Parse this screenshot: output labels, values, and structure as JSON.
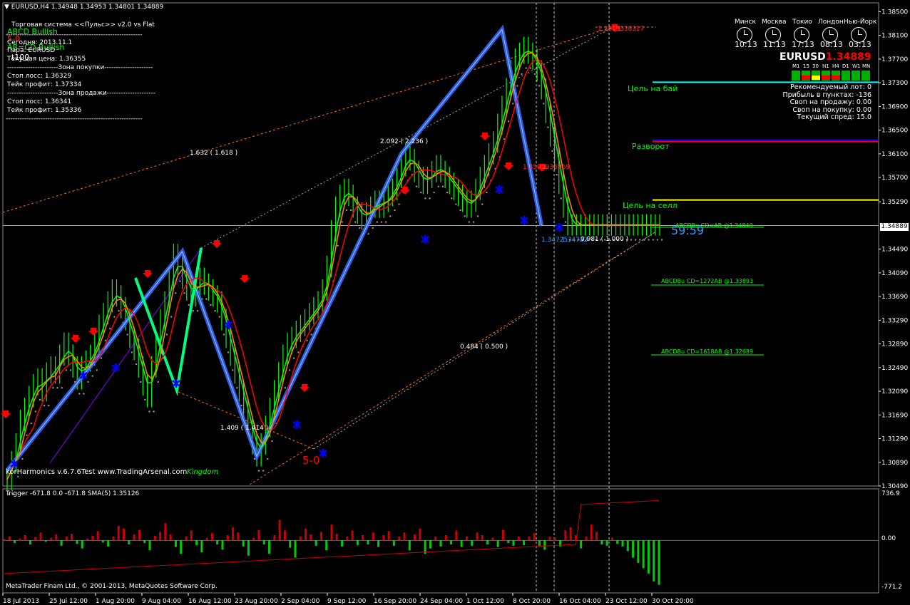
{
  "window": {
    "symbol_header": "EURUSD,H4  1.34948 1.34953 1.34801 1.34889"
  },
  "info_panel": {
    "title": "Торговая система <<Пульс>> v2.0 vs Flat",
    "patterns": [
      "ABCD Bullish",
      "5-0",
      "AB=CD Bullish"
    ],
    "rows": [
      "Сегодня:  2013.11.1",
      "Пара:    EURUSD",
      "Текущая цена: 1.36355",
      "----------------------Зона покупки---------------------",
      "Стоп лосс:       1.36329",
      "Тейк профит:    1.37334",
      "----------------------Зона продажи---------------------",
      "Стоп лосс:       1.36341",
      "Тейк профит:    1.35336"
    ],
    "separator": "-----------------------------------------------------------",
    "mini": "t100"
  },
  "clocks": [
    {
      "city": "Минск",
      "time": "10:13"
    },
    {
      "city": "Москва",
      "time": "11:13"
    },
    {
      "city": "Токио",
      "time": "17:13"
    },
    {
      "city": "Лондон",
      "time": "08:13"
    },
    {
      "city": "Нью-Йорк",
      "time": "03:13"
    }
  ],
  "price_header": {
    "symbol": "EURUSD",
    "price": "1.34889"
  },
  "timeframes": [
    "M1",
    "15",
    "30",
    "H1",
    "H4",
    "D1",
    "W1",
    "MN"
  ],
  "stats": [
    "Рекомендуемый лот: 0",
    "Прибыль в пунктах: -136",
    "Своп на продажу: 0.00",
    "Своп на покупку: 0.00",
    "Текущий спред: 15.0"
  ],
  "annotations": {
    "target_buy": "Цель  на бай",
    "target_sell": "Цель  на селл",
    "reversal": "Разворот",
    "fib_1": "1.632 ( 1.618 )",
    "fib_2": "2.092 ( 2.236 )",
    "fib_3": "1.409 ( 1.414 )",
    "fib_4": "0.484 ( 0.500 )",
    "fib_5": "0.981 ( 1.000 )",
    "point_50": "5-0",
    "countdown": "59:59",
    "top_label": "1.38193",
    "top_label2": "1.38317",
    "mid_label": "1.35999",
    "mid_label2": "1.35969",
    "low_label": "1.34725",
    "low_label2": "1.34722",
    "abcd_1": "ABCDBu CD=AB   @1.34840",
    "abcd_2": "ABCDBu CD=1272AB   @1.33893",
    "abcd_3": "ABCDBu CD=1618AB   @1.32689",
    "harmonics": "korHarmonics v.6.7.6Test  www.TradingArsenal.com",
    "kingdom": "Kingdom"
  },
  "indicator": {
    "label": "Trigger -671.8 0.0 -671.8  SMA(5) 1.35126",
    "y_top": "736.9",
    "y_mid": "0.00",
    "y_bottom": "-771.2"
  },
  "copyright": "MetaTrader Finam Ltd., © 2001-2013, MetaQuotes Software Corp.",
  "colors": {
    "background": "#000000",
    "bull_bars": "#00ff00",
    "bear_arrow": "#ff0000",
    "bull_arrow": "#0000ff",
    "zigzag": "#3366ff",
    "ma_orange": "#ff8c00",
    "ma_green": "#00ff00",
    "target_buy_line": "#00ffff",
    "target_sell_line": "#ffff00",
    "osc_red": "#cc0000",
    "osc_green": "#00cc00"
  },
  "chart_data": {
    "type": "line",
    "title": "",
    "y_ticks": [
      "1.38500",
      "1.38100",
      "1.37700",
      "1.37300",
      "1.36900",
      "1.36500",
      "1.36100",
      "1.35700",
      "1.35290",
      "1.34889",
      "1.34490",
      "1.34090",
      "1.33690",
      "1.33290",
      "1.32890",
      "1.32490",
      "1.32090",
      "1.31690",
      "1.31290",
      "1.30890",
      "1.30490"
    ],
    "ylim": [
      1.3049,
      1.3865
    ],
    "x_ticks": [
      "18 Jul 2013",
      "25 Jul 12:00",
      "1 Aug 20:00",
      "9 Aug 04:00",
      "16 Aug 12:00",
      "23 Aug 20:00",
      "2 Sep 04:00",
      "9 Sep 12:00",
      "16 Sep 20:00",
      "24 Sep 04:00",
      "1 Oct 12:00",
      "8 Oct 20:00",
      "16 Oct 04:00",
      "23 Oct 12:00",
      "30 Oct 20:00"
    ],
    "current_price": 1.34889,
    "target_buy_price": 1.3731,
    "target_sell_price": 1.3532,
    "resistance_price": 1.3632,
    "series": [
      {
        "x": [
          0,
          1,
          2,
          3,
          4,
          5,
          6,
          7,
          8,
          9,
          10,
          11,
          12,
          13,
          14,
          15,
          16,
          17,
          18,
          19,
          20,
          21,
          22,
          23,
          24,
          25,
          26,
          27,
          28,
          29,
          30,
          31,
          32,
          33,
          34,
          35,
          36,
          37,
          38,
          39,
          40,
          41,
          42,
          43,
          44,
          45,
          46,
          47,
          48,
          49,
          50,
          51,
          52,
          53,
          54,
          55,
          56,
          57,
          58,
          59,
          60,
          61,
          62,
          63,
          64,
          65,
          66,
          67,
          68,
          69,
          70,
          71,
          72,
          73,
          74,
          75,
          76,
          77,
          78,
          79,
          80,
          81,
          82,
          83,
          84,
          85,
          86,
          87,
          88,
          89,
          90,
          91,
          92,
          93,
          94,
          95,
          96,
          97,
          98,
          99,
          100,
          101,
          102,
          103,
          104,
          105,
          106,
          107,
          108,
          109,
          110,
          111,
          112,
          113,
          114,
          115,
          116,
          117,
          118,
          119,
          120,
          121,
          122,
          123,
          124,
          125,
          126,
          127,
          128,
          129,
          130,
          131,
          132,
          133,
          134,
          135,
          136,
          137,
          138,
          139,
          140,
          141,
          142,
          143,
          144,
          145,
          146,
          147,
          148,
          149
        ],
        "values": [
          1.306,
          1.309,
          1.312,
          1.316,
          1.318,
          1.32,
          1.322,
          1.323,
          1.321,
          1.324,
          1.325,
          1.324,
          1.327,
          1.329,
          1.327,
          1.325,
          1.323,
          1.325,
          1.326,
          1.327,
          1.329,
          1.332,
          1.334,
          1.336,
          1.338,
          1.337,
          1.335,
          1.333,
          1.33,
          1.328,
          1.325,
          1.322,
          1.32,
          1.325,
          1.329,
          1.333,
          1.336,
          1.34,
          1.344,
          1.342,
          1.34,
          1.338,
          1.337,
          1.339,
          1.34,
          1.339,
          1.338,
          1.337,
          1.336,
          1.333,
          1.33,
          1.327,
          1.324,
          1.321,
          1.318,
          1.315,
          1.312,
          1.31,
          1.312,
          1.315,
          1.318,
          1.321,
          1.324,
          1.327,
          1.329,
          1.33,
          1.331,
          1.332,
          1.333,
          1.334,
          1.335,
          1.336,
          1.338,
          1.342,
          1.348,
          1.352,
          1.354,
          1.355,
          1.354,
          1.352,
          1.351,
          1.35,
          1.351,
          1.352,
          1.353,
          1.352,
          1.353,
          1.354,
          1.355,
          1.357,
          1.359,
          1.361,
          1.36,
          1.358,
          1.357,
          1.356,
          1.357,
          1.358,
          1.359,
          1.358,
          1.357,
          1.356,
          1.355,
          1.354,
          1.353,
          1.352,
          1.353,
          1.355,
          1.357,
          1.359,
          1.361,
          1.363,
          1.366,
          1.369,
          1.372,
          1.375,
          1.377,
          1.378,
          1.379,
          1.378,
          1.377,
          1.375,
          1.372,
          1.368,
          1.364,
          1.36,
          1.356,
          1.352,
          1.349,
          1.349,
          1.349,
          1.349,
          1.349,
          1.349,
          1.349,
          1.349,
          1.349,
          1.349,
          1.349,
          1.349,
          1.349,
          1.349,
          1.349,
          1.349,
          1.349,
          1.349,
          1.349,
          1.349,
          1.349,
          1.349
        ]
      }
    ],
    "zigzag": [
      {
        "x": 0,
        "y": 1.3075
      },
      {
        "x": 40,
        "y": 1.3445
      },
      {
        "x": 57,
        "y": 1.3099
      },
      {
        "x": 90,
        "y": 1.361
      },
      {
        "x": 113,
        "y": 1.382
      },
      {
        "x": 122,
        "y": 1.3489
      }
    ],
    "oscillator": {
      "ylim": [
        -771.2,
        736.9
      ],
      "values": [
        20,
        60,
        -40,
        30,
        80,
        -60,
        50,
        120,
        -20,
        40,
        90,
        -80,
        60,
        100,
        -50,
        -120,
        30,
        70,
        140,
        -30,
        -90,
        60,
        220,
        180,
        -60,
        90,
        160,
        -40,
        -150,
        70,
        130,
        260,
        90,
        -100,
        -200,
        60,
        150,
        -70,
        -180,
        40,
        110,
        -60,
        -140,
        80,
        200,
        120,
        -90,
        -230,
        40,
        160,
        -60,
        -200,
        80,
        310,
        150,
        -110,
        -260,
        60,
        180,
        90,
        -80,
        130,
        -150,
        240,
        100,
        -90,
        60,
        150,
        -70,
        80,
        -60,
        120,
        -100,
        80,
        140,
        -80,
        60,
        120,
        -150,
        90,
        180,
        -200,
        -120,
        60,
        -90,
        80,
        -60,
        150,
        -100,
        60,
        -80,
        120,
        80,
        -60,
        40,
        -100,
        160,
        -40,
        -80,
        60,
        -70,
        60,
        110,
        -80,
        -140,
        60,
        40,
        -90,
        150,
        200,
        80,
        -120,
        60,
        240,
        130,
        -60,
        -80,
        40,
        -50,
        -90,
        -160,
        -260,
        -340,
        -420,
        -500,
        -620,
        -671
      ]
    }
  }
}
